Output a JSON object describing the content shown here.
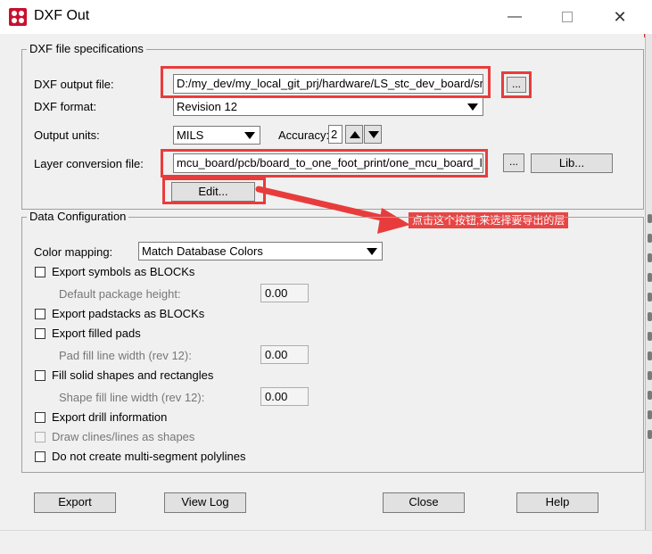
{
  "window": {
    "title": "DXF Out",
    "minimize_icon": "minimize-icon",
    "maximize_icon": "maximize-icon",
    "close_icon": "close-icon"
  },
  "spec_group": {
    "legend": "DXF file specifications",
    "output_file_label": "DXF output file:",
    "output_file_value": "D:/my_dev/my_local_git_prj/hardware/LS_stc_dev_board/src",
    "browse_output": "...",
    "format_label": "DXF format:",
    "format_value": "Revision 12",
    "units_label": "Output units:",
    "units_value": "MILS",
    "accuracy_label": "Accuracy:",
    "accuracy_value": "2",
    "layer_file_label": "Layer conversion file:",
    "layer_file_value": "mcu_board/pcb/board_to_one_foot_print/one_mcu_board_l",
    "browse_layer": "...",
    "lib_button": "Lib...",
    "edit_button": "Edit..."
  },
  "annotation": {
    "text": "点击这个按钮,来选择要导出的层",
    "color": "#e84545"
  },
  "data_group": {
    "legend": "Data Configuration",
    "color_mapping_label": "Color mapping:",
    "color_mapping_value": "Match Database Colors",
    "export_symbols": "Export symbols as BLOCKs",
    "pkg_height_label": "Default package height:",
    "pkg_height_value": "0.00",
    "export_padstacks": "Export padstacks as BLOCKs",
    "export_filled_pads": "Export filled pads",
    "pad_fill_label": "Pad fill line width (rev 12):",
    "pad_fill_value": "0.00",
    "fill_solid": "Fill solid shapes and rectangles",
    "shape_fill_label": "Shape fill line width (rev 12):",
    "shape_fill_value": "0.00",
    "export_drill": "Export drill information",
    "draw_clines": "Draw clines/lines as shapes",
    "no_multisegment": "Do not create multi-segment polylines"
  },
  "footer": {
    "export": "Export",
    "view_log": "View Log",
    "close": "Close",
    "help": "Help"
  }
}
